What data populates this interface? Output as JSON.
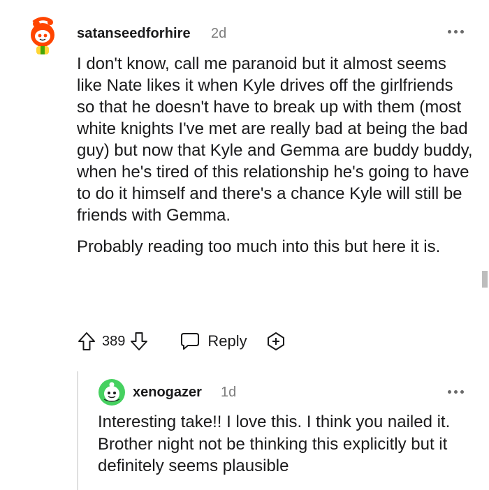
{
  "comment": {
    "username": "satanseedforhire",
    "age": "2d",
    "paragraphs": [
      "I don't know, call me paranoid but it almost seems like Nate likes it when Kyle drives off the girlfriends so that he doesn't have to break up with them (most white knights I've met are really bad at being the bad guy) but now that Kyle and Gemma are buddy buddy, when he's tired of this relationship he's going to have to do it himself and there's a chance Kyle will still be friends with Gemma.",
      "Probably reading too much into this but here it is."
    ],
    "score": "389",
    "reply_label": "Reply",
    "avatar_icon": "snoo-avatar-icon"
  },
  "reply": {
    "username": "xenogazer",
    "age": "1d",
    "text": "Interesting take!! I love this. I think you nailed it. Brother night not be thinking this explicitly but it definitely seems plausible",
    "avatar_icon": "snoo-avatar-icon"
  },
  "colors": {
    "text": "#1a1a1b",
    "meta": "#7c7c7c",
    "thread_line": "#e0e0e0",
    "avatar_accent": "#ff4500",
    "reply_avatar_accent": "#46d160"
  }
}
